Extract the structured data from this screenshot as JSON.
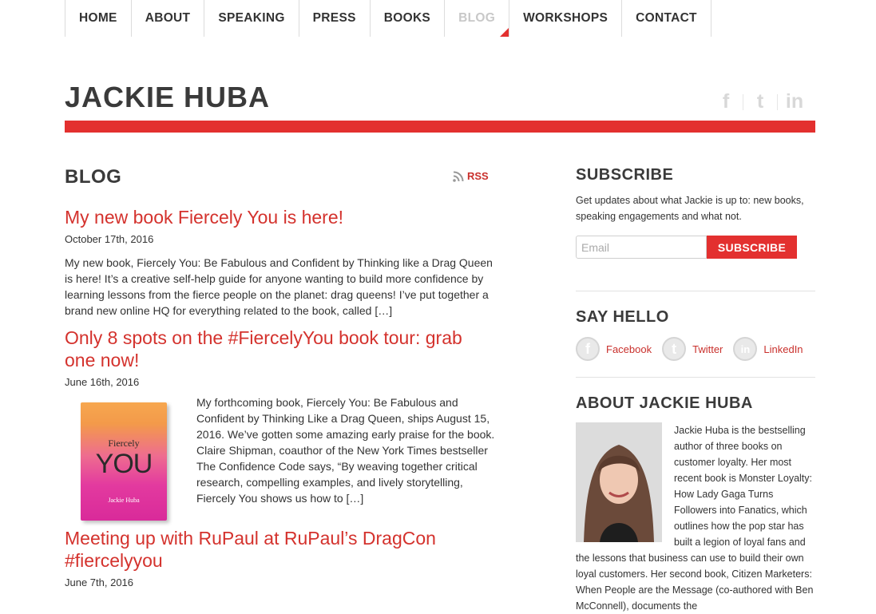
{
  "nav": {
    "items": [
      {
        "label": "HOME"
      },
      {
        "label": "ABOUT"
      },
      {
        "label": "SPEAKING"
      },
      {
        "label": "PRESS"
      },
      {
        "label": "BOOKS"
      },
      {
        "label": "BLOG",
        "active": true
      },
      {
        "label": "WORKSHOPS"
      },
      {
        "label": "CONTACT"
      }
    ]
  },
  "header": {
    "site_title": "JACKIE HUBA",
    "social_icons": [
      "facebook-icon",
      "twitter-icon",
      "linkedin-icon"
    ],
    "social_glyphs": [
      "f",
      "t",
      "in"
    ],
    "accent_color": "#e3302f"
  },
  "main": {
    "heading": "BLOG",
    "rss_label": "RSS",
    "posts": [
      {
        "title": "My new book Fiercely You is here!",
        "date": "October 17th, 2016",
        "excerpt": "My new book, Fiercely You: Be Fabulous and Confident by Thinking like a Drag Queen is here! It’s a creative self-help guide for anyone wanting to build more confidence by learning lessons from the fierce people on the planet: drag queens! I’ve put together a brand new online HQ for everything related to the book, called […]"
      },
      {
        "title": "Only 8 spots on the #FiercelyYou book tour: grab one now!",
        "date": "June 16th, 2016",
        "excerpt": "My forthcoming book, Fiercely You: Be Fabulous and Confident by Thinking Like a Drag Queen, ships August 15, 2016. We’ve gotten some amazing early praise for the book. Claire Shipman, coauthor of the New York Times bestseller The Confidence Code says, “By weaving together critical research, compelling examples, and lively storytelling, Fiercely You shows us how to […]",
        "book": {
          "word1": "Fiercely",
          "word2": "YOU",
          "author": "Jackie Huba"
        }
      },
      {
        "title": "Meeting up with RuPaul at RuPaul’s DragCon #fiercelyyou",
        "date": "June 7th, 2016"
      }
    ]
  },
  "sidebar": {
    "subscribe": {
      "heading": "SUBSCRIBE",
      "text": "Get updates about what Jackie is up to: new books, speaking engagements and what not.",
      "email_placeholder": "Email",
      "email_value": "",
      "button_label": "SUBSCRIBE"
    },
    "hello": {
      "heading": "SAY HELLO",
      "links": [
        {
          "label": "Facebook",
          "icon": "facebook-icon",
          "glyph": "f"
        },
        {
          "label": "Twitter",
          "icon": "twitter-icon",
          "glyph": "t"
        },
        {
          "label": "LinkedIn",
          "icon": "linkedin-icon",
          "glyph": "in"
        }
      ]
    },
    "about": {
      "heading": "ABOUT JACKIE HUBA",
      "text": "Jackie Huba is the bestselling author of three books on customer loyalty. Her most recent book is Monster Loyalty: How Lady Gaga Turns Followers into Fanatics, which outlines how the pop star has built a legion of loyal fans and the lessons that business can use to build their own loyal customers. Her second book, Citizen Marketers: When People are the Message (co-authored with Ben McConnell), documents the"
    }
  }
}
